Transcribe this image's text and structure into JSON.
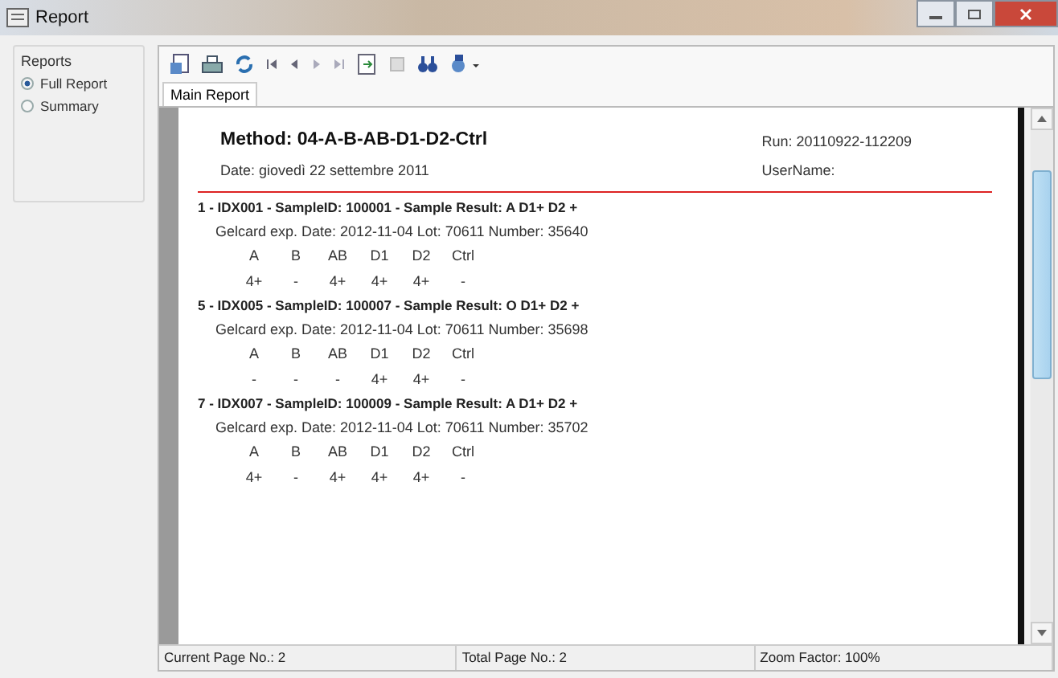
{
  "window": {
    "title": "Report"
  },
  "sidebar": {
    "group_title": "Reports",
    "options": [
      {
        "label": "Full Report",
        "selected": true
      },
      {
        "label": "Summary",
        "selected": false
      }
    ]
  },
  "tabs": [
    {
      "label": "Main Report",
      "selected": true
    }
  ],
  "report": {
    "method": "Method: 04-A-B-AB-D1-D2-Ctrl",
    "run": "Run: 20110922-112209",
    "date": "Date: giovedì 22 settembre 2011",
    "user": "UserName:",
    "samples": [
      {
        "title": "1 - IDX001 - SampleID: 100001 - Sample Result: A D1+ D2 +",
        "gelcard": "Gelcard exp. Date: 2012-11-04 Lot: 70611 Number: 35640",
        "headers": [
          "A",
          "B",
          "AB",
          "D1",
          "D2",
          "Ctrl"
        ],
        "values": [
          "4+",
          "-",
          "4+",
          "4+",
          "4+",
          "-"
        ]
      },
      {
        "title": "5 - IDX005 - SampleID: 100007 - Sample Result: O D1+ D2 +",
        "gelcard": "Gelcard exp. Date: 2012-11-04 Lot: 70611 Number: 35698",
        "headers": [
          "A",
          "B",
          "AB",
          "D1",
          "D2",
          "Ctrl"
        ],
        "values": [
          "-",
          "-",
          "-",
          "4+",
          "4+",
          "-"
        ]
      },
      {
        "title": "7 - IDX007 - SampleID: 100009 - Sample Result: A D1+ D2 +",
        "gelcard": "Gelcard exp. Date: 2012-11-04 Lot: 70611 Number: 35702",
        "headers": [
          "A",
          "B",
          "AB",
          "D1",
          "D2",
          "Ctrl"
        ],
        "values": [
          "4+",
          "-",
          "4+",
          "4+",
          "4+",
          "-"
        ]
      }
    ]
  },
  "status_bar": [
    "Current Page No.: 2",
    "Total Page No.: 2",
    "Zoom Factor: 100%"
  ]
}
